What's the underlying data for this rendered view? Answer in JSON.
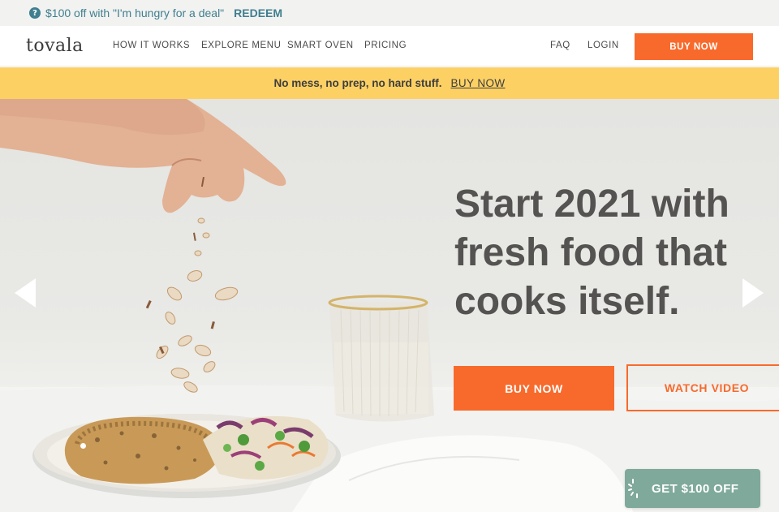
{
  "promo": {
    "icon": "question-icon",
    "text": "$100 off with \"I'm hungry for a deal\"",
    "redeem_label": "REDEEM",
    "accent": "#3f7f8f"
  },
  "nav": {
    "logo": "tovala",
    "links": [
      "HOW IT WORKS",
      "EXPLORE MENU",
      "SMART OVEN",
      "PRICING"
    ],
    "faq": "FAQ",
    "login": "LOGIN",
    "buy_label": "BUY NOW"
  },
  "banner": {
    "text": "No mess, no prep, no hard stuff.",
    "link": "BUY NOW",
    "color": "#fdd064"
  },
  "hero": {
    "headline": "Start 2021 with fresh food that cooks itself.",
    "buy_label": "BUY NOW",
    "watch_label": "WATCH VIDEO",
    "prev_icon": "chevron-left-icon",
    "next_icon": "chevron-right-icon",
    "slide_indicator": "1"
  },
  "floating": {
    "label": "GET $100 OFF",
    "icon": "sparkle-icon",
    "color": "#7fa99b"
  },
  "colors": {
    "brand_orange": "#f86a2b",
    "headline_gray": "#555351"
  }
}
